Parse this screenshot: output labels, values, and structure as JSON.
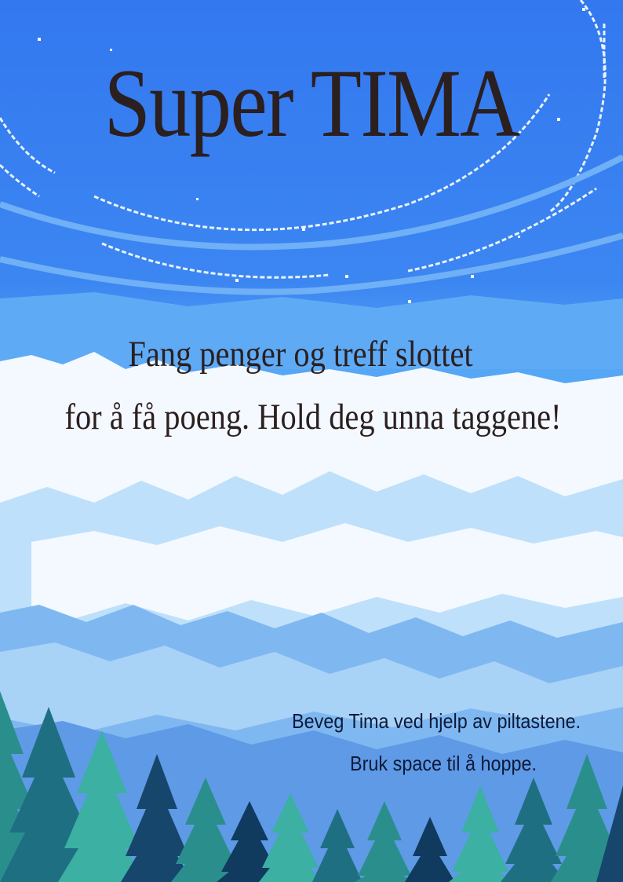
{
  "game": {
    "title": "Super TIMA",
    "subtitle_line1": "Fang penger og treff slottet",
    "subtitle_line2": "for å få poeng. Hold deg unna taggene!",
    "instruction_line1": "Beveg Tima ved hjelp av piltastene.",
    "instruction_line2": "Bruk space til å hoppe."
  },
  "colors": {
    "sky": "#3b7ff0",
    "text_dark": "#2b1f1f",
    "instruction_text": "#0d1a3a"
  }
}
